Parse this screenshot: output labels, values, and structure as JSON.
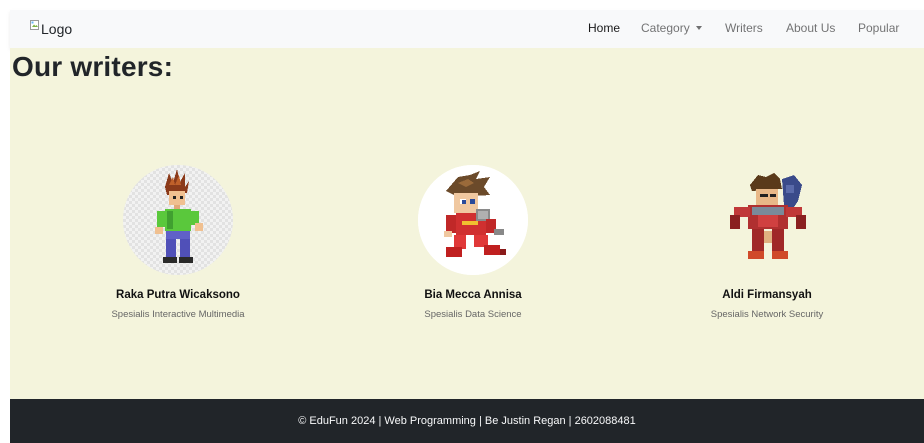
{
  "navbar": {
    "logo_alt": "Logo",
    "links": [
      {
        "label": "Home",
        "active": true
      },
      {
        "label": "Category",
        "dropdown": true
      },
      {
        "label": "Writers"
      },
      {
        "label": "About Us"
      },
      {
        "label": "Popular"
      }
    ]
  },
  "main": {
    "title": "Our writers:",
    "background": "#f4f4dc",
    "writers": [
      {
        "name": "Raka Putra Wicaksono",
        "specialty": "Spesialis Interactive Multimedia",
        "avatar_icon": "pixel-character-green-shirt-icon"
      },
      {
        "name": "Bia Mecca Annisa",
        "specialty": "Spesialis Data Science",
        "avatar_icon": "pixel-character-red-hero-icon"
      },
      {
        "name": "Aldi Firmansyah",
        "specialty": "Spesialis Network Security",
        "avatar_icon": "pixel-character-red-armor-icon"
      }
    ]
  },
  "footer": {
    "text": "© EduFun 2024 | Web Programming | Be Justin Regan | 2602088481",
    "background": "#212529"
  }
}
